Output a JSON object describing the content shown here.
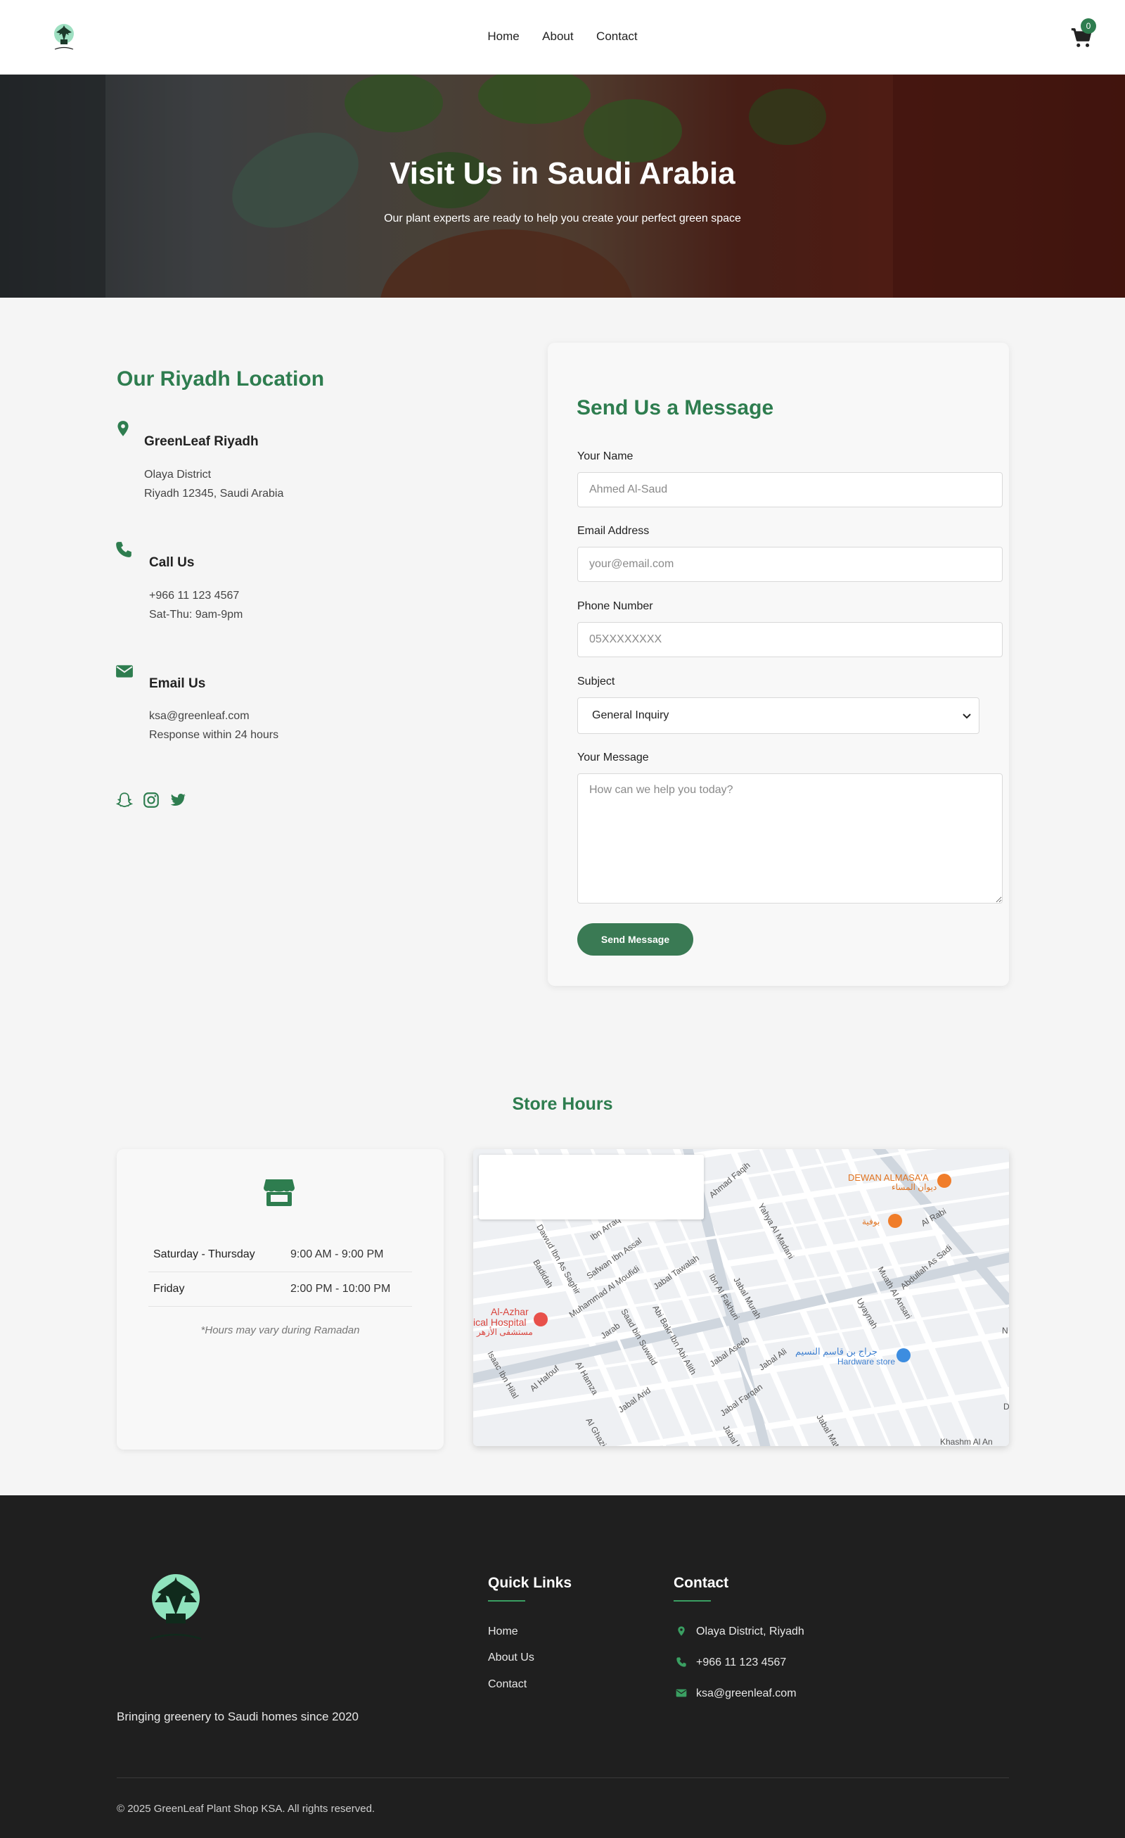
{
  "header": {
    "nav": [
      "Home",
      "About",
      "Contact"
    ],
    "cart_count": "0"
  },
  "hero": {
    "title": "Visit Us in Saudi Arabia",
    "subtitle": "Our plant experts are ready to help you create your perfect green space"
  },
  "location": {
    "title": "Our Riyadh Location",
    "address": {
      "title": "GreenLeaf Riyadh",
      "line1": "Olaya District",
      "line2": "Riyadh 12345, Saudi Arabia"
    },
    "phone": {
      "title": "Call Us",
      "line1": "+966 11 123 4567",
      "line2": "Sat-Thu: 9am-9pm"
    },
    "email": {
      "title": "Email Us",
      "line1": "ksa@greenleaf.com",
      "line2": "Response within 24 hours"
    }
  },
  "form": {
    "title": "Send Us a Message",
    "name_label": "Your Name",
    "name_placeholder": "Ahmed Al-Saud",
    "email_label": "Email Address",
    "email_placeholder": "your@email.com",
    "phone_label": "Phone Number",
    "phone_placeholder": "05XXXXXXXX",
    "subject_label": "Subject",
    "subject_value": "General Inquiry",
    "message_label": "Your Message",
    "message_placeholder": "How can we help you today?",
    "submit_label": "Send Message"
  },
  "hours": {
    "title": "Store Hours",
    "rows": [
      {
        "day": "Saturday - Thursday",
        "time": "9:00 AM - 9:00 PM"
      },
      {
        "day": "Friday",
        "time": "2:00 PM - 10:00 PM"
      }
    ],
    "note": "*Hours may vary during Ramadan"
  },
  "map_labels": {
    "l1": "DEWAN ALMASA'A",
    "l2": "ديوان المساء",
    "l3": "بوفية",
    "l4": "Al-Azhar",
    "l5": "ical Hospital",
    "l6": "مستشفى الأزهر",
    "l7": "جراج بن قاسم النسيم",
    "l8": "Hardware store",
    "streets": [
      "Ahmad Faqih",
      "Yahya Al Madani",
      "Al Rabi",
      "Abdullah As Sadi",
      "Muath Al Ansari",
      "Uyaynah",
      "Ibn Arraq",
      "Dawud Ibn As Saghir",
      "Badidah",
      "Safwan Ibn Assal",
      "Muhammad Al Moufidi",
      "Jabal Tawalah",
      "Ibn Al Fakhuri",
      "Abi Bakr Ibn Abi Alith",
      "Jabal Murah",
      "Jabal Aseeb",
      "Jabal Ali",
      "Jarab",
      "Saad bin Suwaid",
      "Isaac Ibn Hilal",
      "Al Hafouf",
      "Al Hamza",
      "Jabal Arid",
      "Jabal Farqan",
      "Jabal Kam",
      "Jabal Mat",
      "Khashm Al An",
      "Al Ghazi",
      "N",
      "D"
    ]
  },
  "footer": {
    "tagline": "Bringing greenery to Saudi homes since 2020",
    "links_title": "Quick Links",
    "links": [
      "Home",
      "About Us",
      "Contact"
    ],
    "contact_title": "Contact",
    "contact": [
      "Olaya District, Riyadh",
      "+966 11 123 4567",
      "ksa@greenleaf.com"
    ],
    "copyright": "© 2025 GreenLeaf Plant Shop KSA. All rights reserved."
  },
  "colors": {
    "brand": "#2e7d4f",
    "button": "#3a7a54",
    "footer_bg": "#1f1f1f"
  }
}
